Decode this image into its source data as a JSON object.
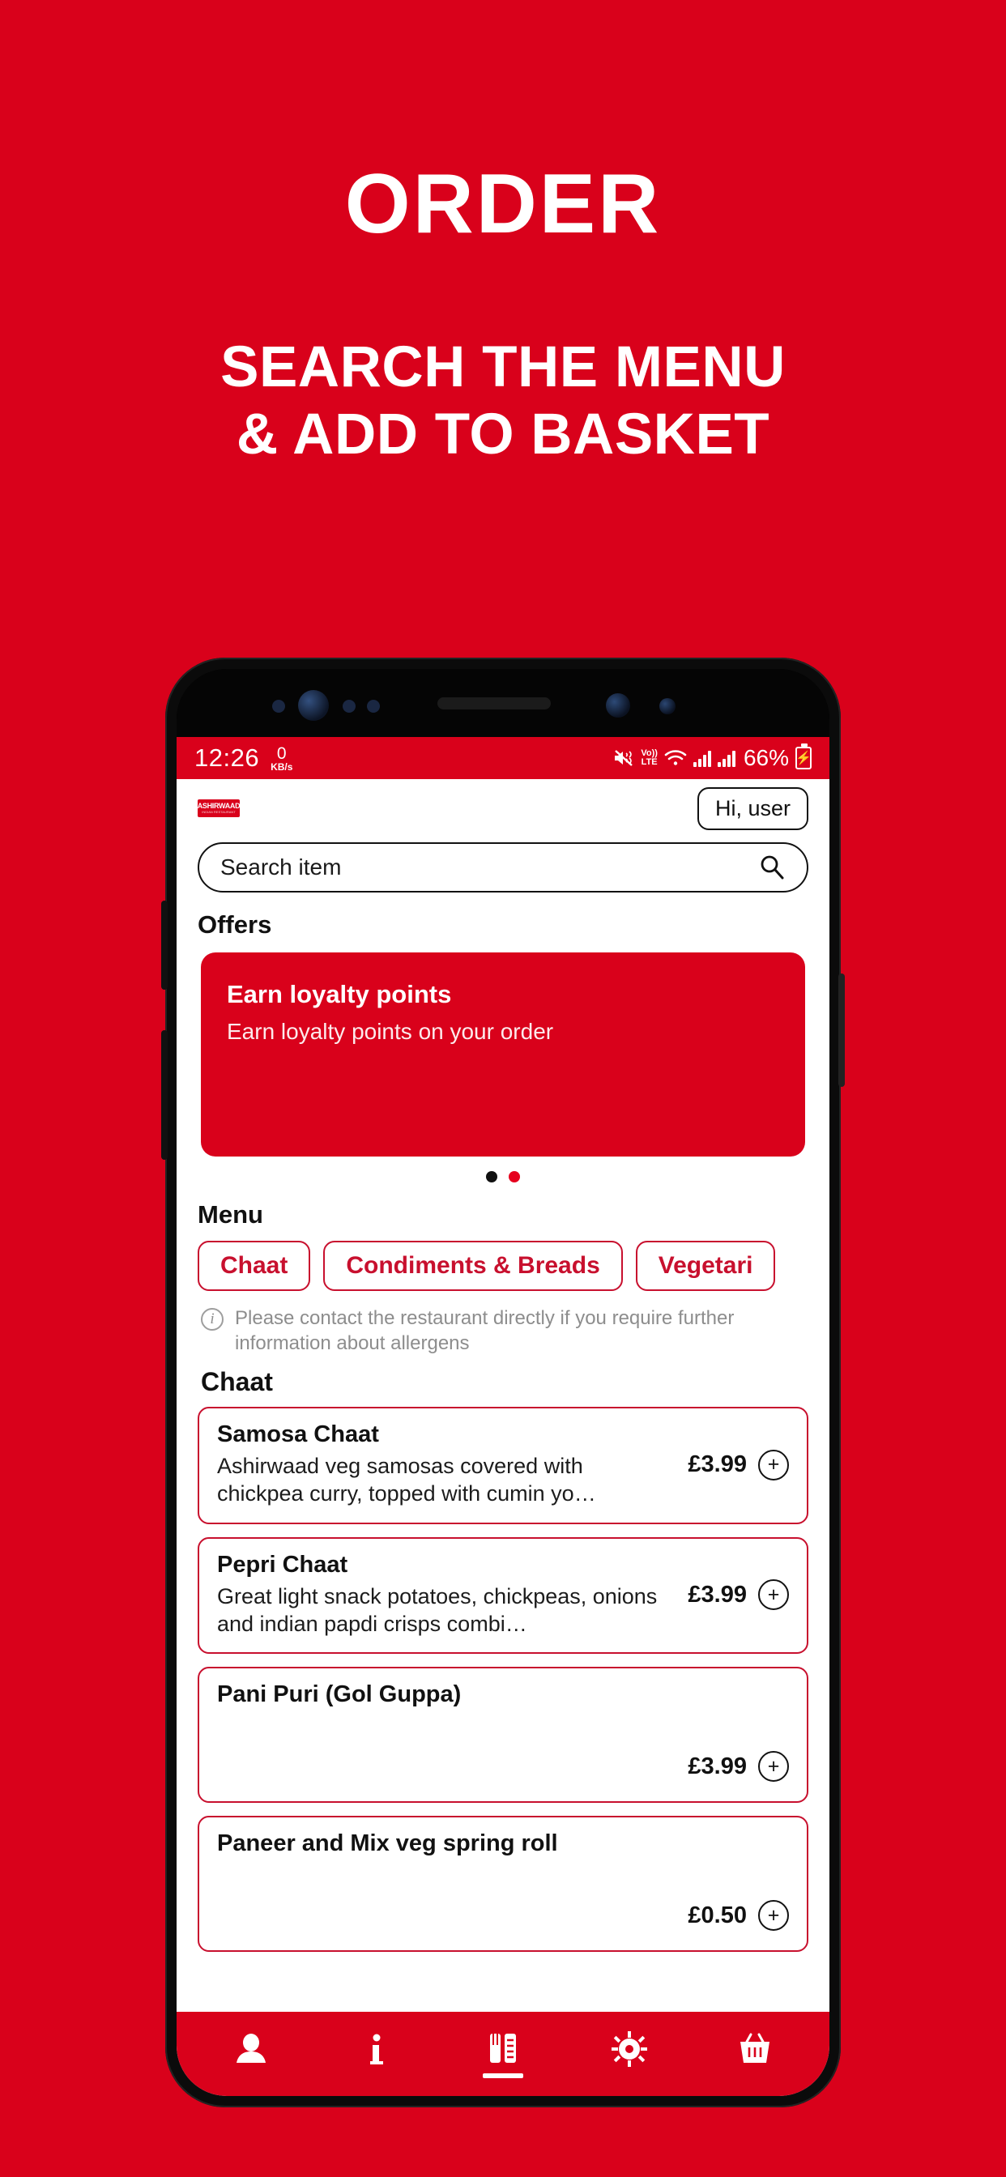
{
  "promo": {
    "title": "ORDER",
    "subtitle_line1": "SEARCH THE MENU",
    "subtitle_line2": "& ADD TO BASKET",
    "background_color": "#d9011b",
    "text_color": "#ffffff"
  },
  "status_bar": {
    "time": "12:26",
    "network_speed_value": "0",
    "network_speed_unit": "KB/s",
    "icons": [
      "mute-icon",
      "volte-icon",
      "wifi-icon",
      "signal-icon-1",
      "signal-icon-2"
    ],
    "volte_line1": "Vo))",
    "volte_line2": "LTE",
    "battery_percent": "66%",
    "battery_state": "charging",
    "background_color": "#d9011b"
  },
  "app_header": {
    "logo_line1": "ASHIRWAAD",
    "logo_line2": "INDIAN RESTAURANT",
    "greeting_button": "Hi, user"
  },
  "search": {
    "placeholder": "Search item",
    "value": "",
    "icon": "search-icon"
  },
  "offers": {
    "section_title": "Offers",
    "card": {
      "title": "Earn loyalty points",
      "subtitle": "Earn loyalty points on your order",
      "background_color": "#d9011b"
    },
    "pager": {
      "total": 2,
      "active_index": 1,
      "inactive_color": "#111111",
      "active_color": "#e6001e"
    }
  },
  "menu": {
    "section_title": "Menu",
    "categories": [
      {
        "label": "Chaat"
      },
      {
        "label": "Condiments & Breads"
      },
      {
        "label": "Vegetari"
      }
    ],
    "allergen_notice": "Please contact the restaurant directly if you require further information about allergens",
    "allergen_icon": "info-icon",
    "current_category": "Chaat",
    "items": [
      {
        "name": "Samosa Chaat",
        "description": "Ashirwaad veg samosas covered with chickpea curry, topped with cumin yo…",
        "price": "£3.99",
        "add_label": "+"
      },
      {
        "name": "Pepri Chaat",
        "description": "Great light snack potatoes, chickpeas, onions and indian papdi crisps combi…",
        "price": "£3.99",
        "add_label": "+"
      },
      {
        "name": "Pani Puri (Gol Guppa)",
        "description": "",
        "price": "£3.99",
        "add_label": "+"
      },
      {
        "name": "Paneer and Mix veg spring roll",
        "description": "",
        "price": "£0.50",
        "add_label": "+"
      }
    ]
  },
  "bottom_nav": {
    "background_color": "#d9011b",
    "items": [
      {
        "icon": "person-icon",
        "active": false
      },
      {
        "icon": "info-icon",
        "active": false
      },
      {
        "icon": "menu-cutlery-icon",
        "active": true
      },
      {
        "icon": "gear-icon",
        "active": false
      },
      {
        "icon": "basket-icon",
        "active": false
      }
    ]
  },
  "theme": {
    "brand_red": "#d9011b",
    "accent_red": "#c8102e",
    "text_dark": "#111111"
  }
}
